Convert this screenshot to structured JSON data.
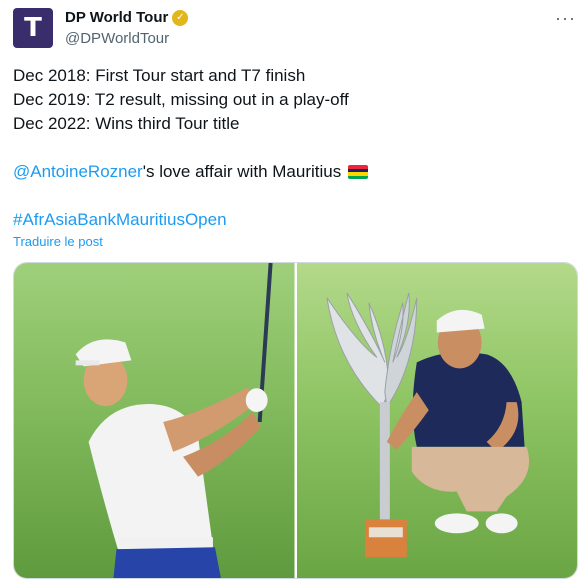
{
  "account": {
    "display_name": "DP World Tour",
    "handle": "@DPWorldTour",
    "avatar_letter": "T"
  },
  "tweet": {
    "line1": "Dec 2018: First Tour start and T7 finish",
    "line2": "Dec 2019: T2 result, missing out in a play-off",
    "line3": "Dec 2022: Wins third Tour title",
    "mention": "@AntoineRozner",
    "mention_suffix": "'s love affair with Mauritius ",
    "hashtag": "#AfrAsiaBankMauritiusOpen"
  },
  "translate_label": "Traduire le post",
  "icons": {
    "verified": "verified-badge-icon",
    "more": "more-options-icon",
    "flag": "mauritius-flag-icon"
  },
  "colors": {
    "link": "#1d9bf0",
    "secondary_text": "#536471",
    "verified_gold": "#e2b719",
    "avatar_bg": "#3a2d6b"
  },
  "media": [
    {
      "description_name": "golfer-swing-photo"
    },
    {
      "description_name": "golfer-with-trophy-photo",
      "trophy_base_text": "AFRASIA BANK"
    }
  ]
}
